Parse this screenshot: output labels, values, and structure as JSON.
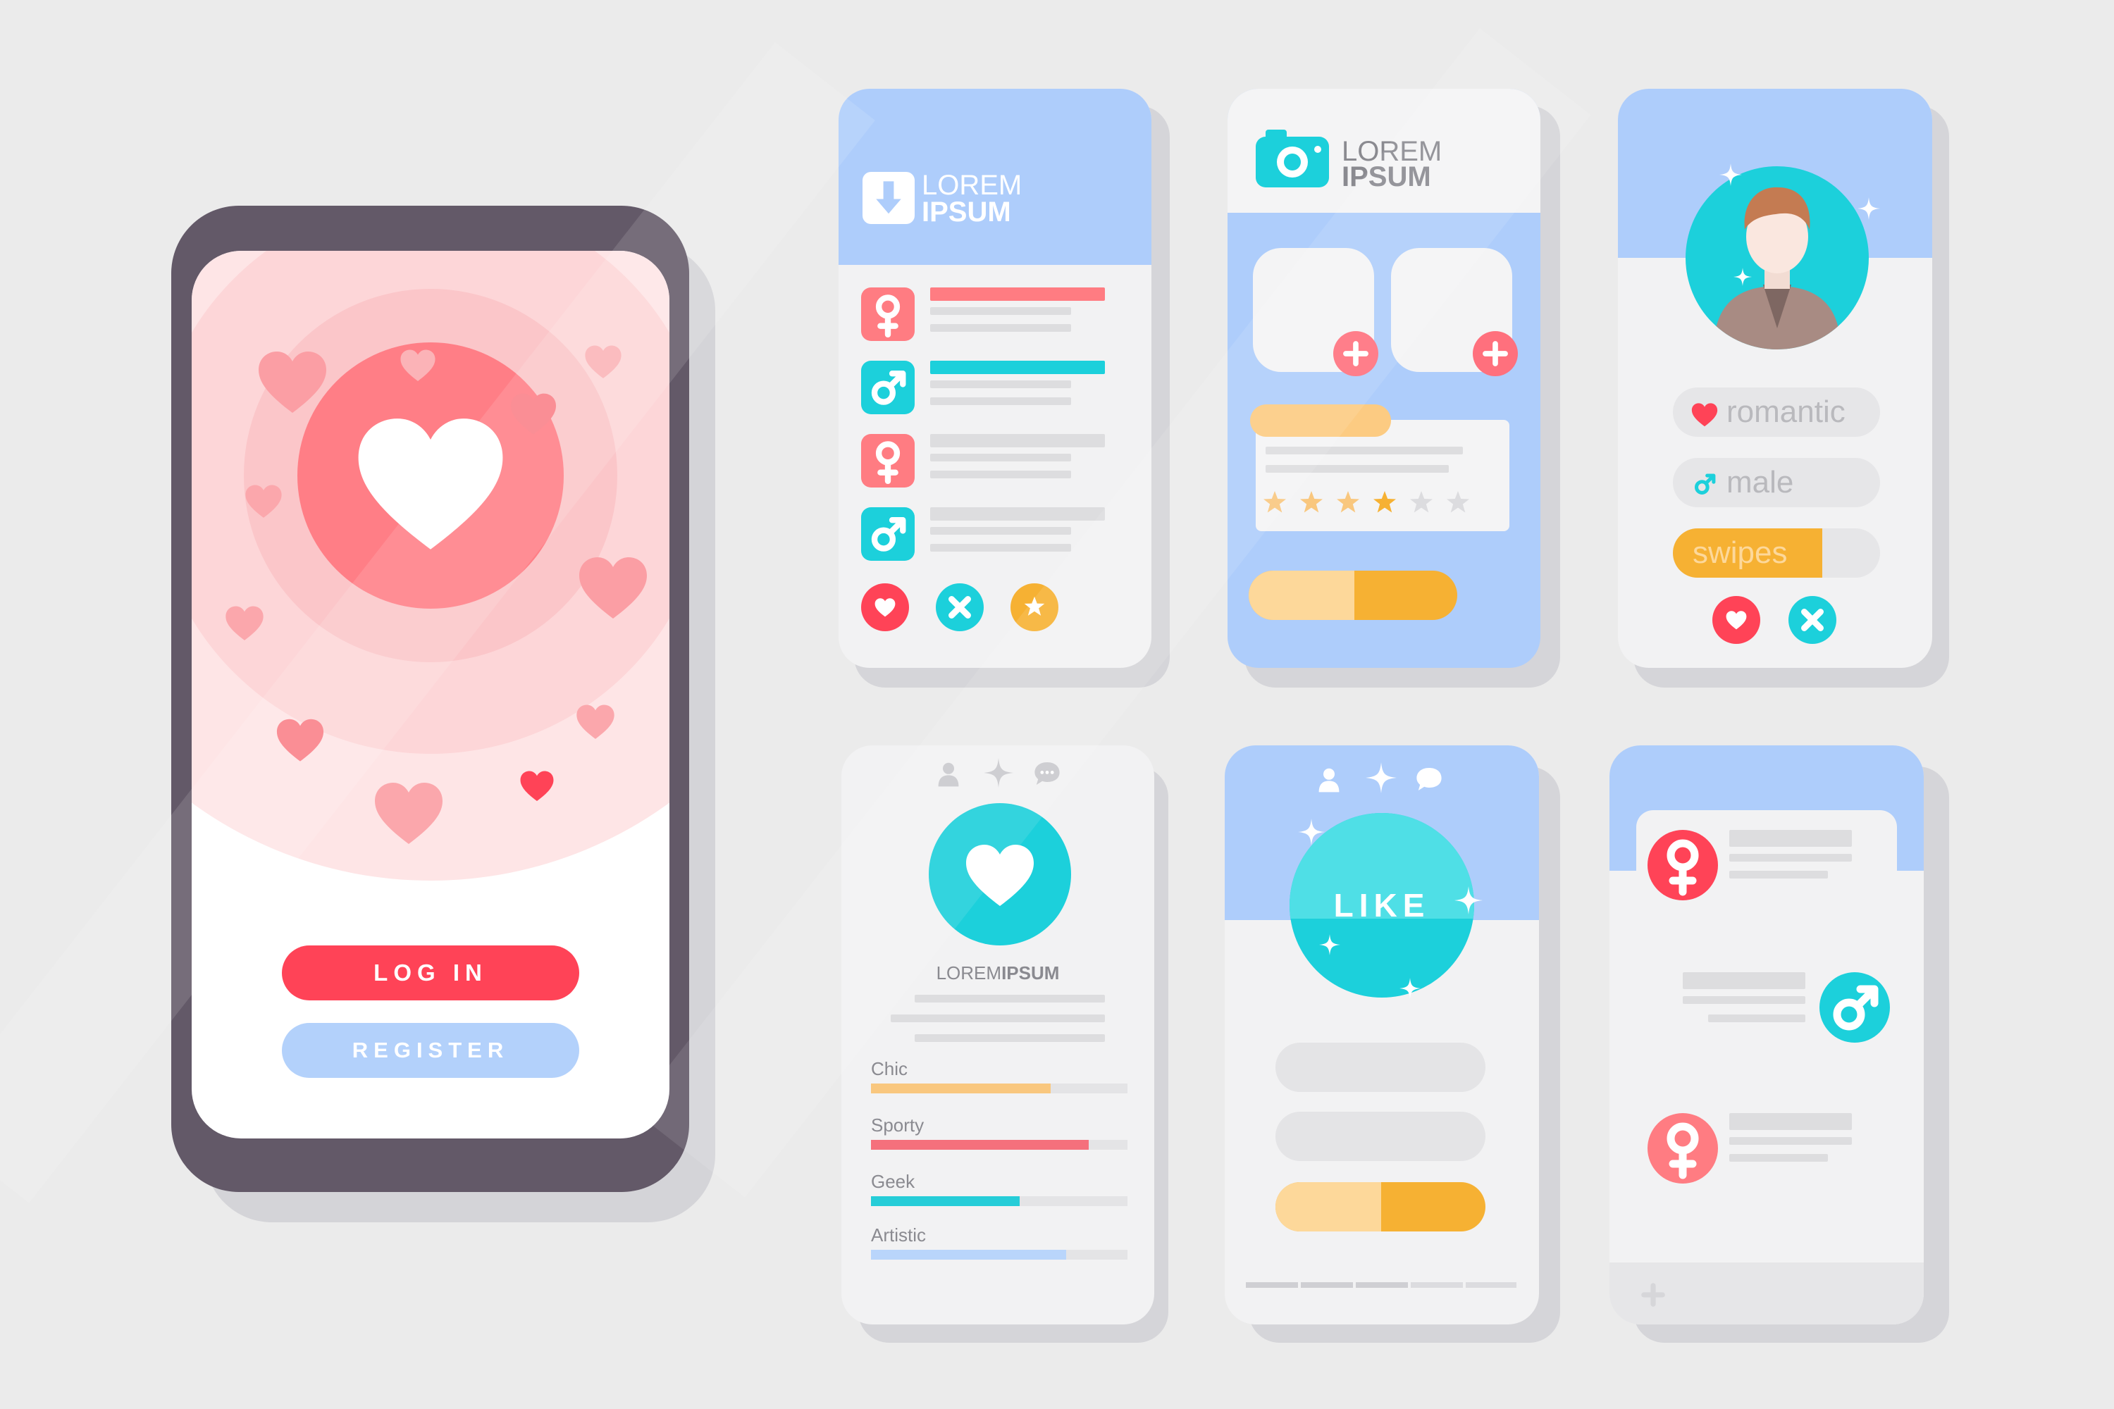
{
  "login_screen": {
    "login_button": "LOG IN",
    "register_button": "REGISTER",
    "colors": {
      "accent": "#ff4357",
      "heart_circle": "#ff7e86",
      "register": "#b3d1fb",
      "phone_body": "#635968"
    }
  },
  "list_screen": {
    "logo_line1": "LOREM",
    "logo_line2": "IPSUM",
    "rows": [
      {
        "icon": "female-icon",
        "accent": "#ff7c82"
      },
      {
        "icon": "male-icon",
        "accent": "#1cd0db"
      },
      {
        "icon": "female-icon",
        "accent": "#dddddf"
      },
      {
        "icon": "male-icon",
        "accent": "#dddddf"
      }
    ],
    "actions": [
      "heart-icon",
      "close-icon",
      "star-icon"
    ]
  },
  "photo_screen": {
    "logo_line1": "LOREM",
    "logo_line2": "IPSUM",
    "rating": 4,
    "rating_max": 6
  },
  "profile_screen": {
    "tags": [
      {
        "label": "romantic",
        "icon": "heart-icon"
      },
      {
        "label": "male",
        "icon": "male-icon"
      },
      {
        "label": "swipes",
        "icon": ""
      }
    ],
    "swipes_level": 0.72,
    "actions": [
      "heart-icon",
      "close-icon"
    ]
  },
  "stats_screen": {
    "name_regular": "LOREM",
    "name_bold": "IPSUM",
    "bars": [
      {
        "label": "Chic",
        "value": 0.7,
        "color": "#f9c77e"
      },
      {
        "label": "Sporty",
        "value": 0.85,
        "color": "#f5707c"
      },
      {
        "label": "Geek",
        "value": 0.58,
        "color": "#26cdd8"
      },
      {
        "label": "Artistic",
        "value": 0.76,
        "color": "#b9d5fb"
      }
    ]
  },
  "like_screen": {
    "like_label": "LIKE"
  },
  "chat_screen": {
    "messages": [
      {
        "side": "left",
        "icon": "female-icon",
        "color": "#ff4357"
      },
      {
        "side": "right",
        "icon": "male-icon",
        "color": "#1cd0db"
      },
      {
        "side": "left",
        "icon": "female-icon",
        "color": "#ff7c82"
      }
    ]
  }
}
